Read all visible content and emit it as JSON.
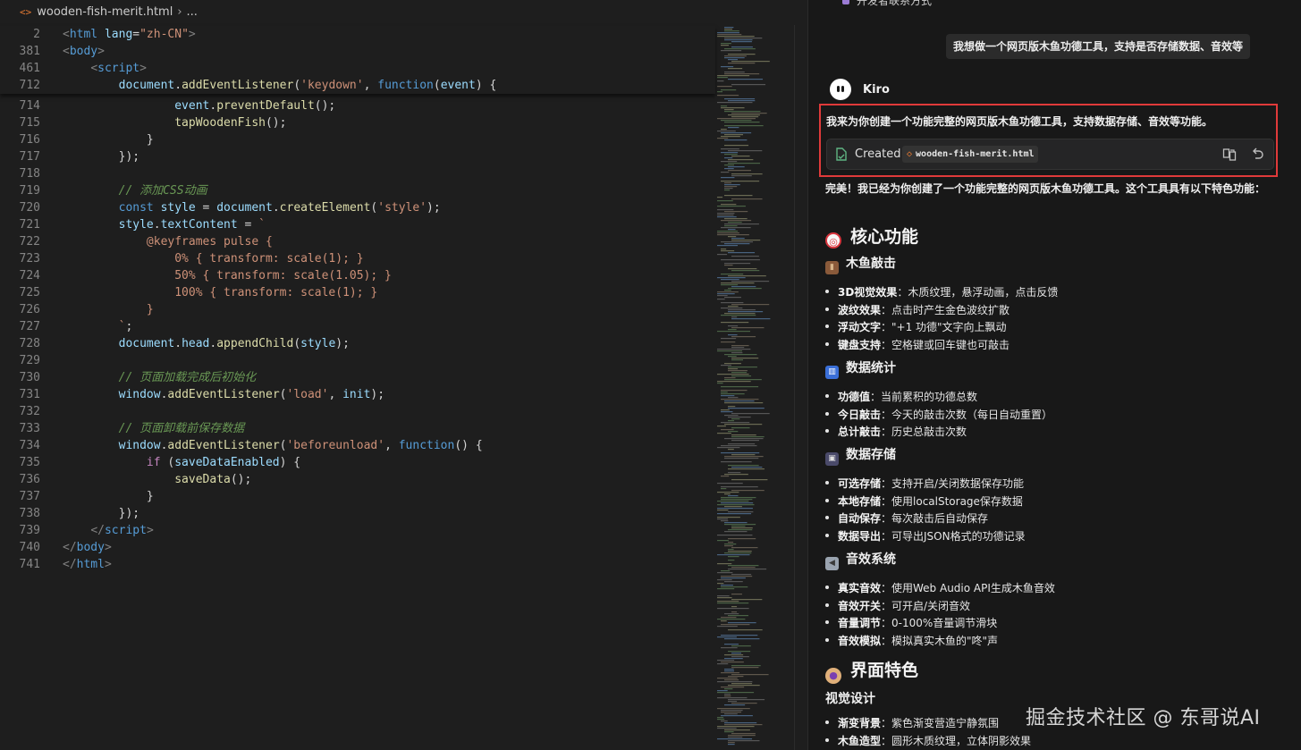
{
  "editor": {
    "file_icon": "<>",
    "filename": "wooden-fish-merit.html",
    "breadcrumb_more": "...",
    "sticky_lines": [
      {
        "n": "2",
        "html": "<span class='t-pun'>&lt;</span><span class='t-tag'>html</span> <span class='t-attr'>lang</span><span class='t-txt'>=</span><span class='t-str'>\"zh-CN\"</span><span class='t-pun'>&gt;</span>"
      },
      {
        "n": "381",
        "html": "<span class='t-pun'>&lt;</span><span class='t-tag'>body</span><span class='t-pun'>&gt;</span>"
      },
      {
        "n": "461",
        "html": "    <span class='t-pun'>&lt;</span><span class='t-tag'>script</span><span class='t-pun'>&gt;</span>"
      },
      {
        "n": "712",
        "html": "        <span class='t-var'>document</span>.<span class='t-fn'>addEventListener</span>(<span class='t-str'>'keydown'</span>, <span class='t-kw'>function</span>(<span class='t-var'>event</span>) {"
      }
    ],
    "lines": [
      {
        "n": "714",
        "html": "                <span class='t-var'>event</span>.<span class='t-fn'>preventDefault</span>();"
      },
      {
        "n": "715",
        "html": "                <span class='t-fn'>tapWoodenFish</span>();"
      },
      {
        "n": "716",
        "html": "            }"
      },
      {
        "n": "717",
        "html": "        });"
      },
      {
        "n": "718",
        "html": ""
      },
      {
        "n": "719",
        "html": "        <span class='t-com'>// 添加CSS动画</span>"
      },
      {
        "n": "720",
        "html": "        <span class='t-kw'>const</span> <span class='t-var'>style</span> = <span class='t-var'>document</span>.<span class='t-fn'>createElement</span>(<span class='t-str'>'style'</span>);"
      },
      {
        "n": "721",
        "html": "        <span class='t-var'>style</span>.<span class='t-var'>textContent</span> = <span class='t-tpl'>`</span>"
      },
      {
        "n": "722",
        "html": "<span class='t-tpl'>            @keyframes pulse {</span>"
      },
      {
        "n": "723",
        "html": "<span class='t-tpl'>                0% { transform: scale(1); }</span>"
      },
      {
        "n": "724",
        "html": "<span class='t-tpl'>                50% { transform: scale(1.05); }</span>"
      },
      {
        "n": "725",
        "html": "<span class='t-tpl'>                100% { transform: scale(1); }</span>"
      },
      {
        "n": "726",
        "html": "<span class='t-tpl'>            }</span>"
      },
      {
        "n": "727",
        "html": "<span class='t-tpl'>        `</span>;"
      },
      {
        "n": "728",
        "html": "        <span class='t-var'>document</span>.<span class='t-var'>head</span>.<span class='t-fn'>appendChild</span>(<span class='t-var'>style</span>);"
      },
      {
        "n": "729",
        "html": ""
      },
      {
        "n": "730",
        "html": "        <span class='t-com'>// 页面加载完成后初始化</span>"
      },
      {
        "n": "731",
        "html": "        <span class='t-var'>window</span>.<span class='t-fn'>addEventListener</span>(<span class='t-str'>'load'</span>, <span class='t-var'>init</span>);"
      },
      {
        "n": "732",
        "html": ""
      },
      {
        "n": "733",
        "html": "        <span class='t-com'>// 页面卸载前保存数据</span>"
      },
      {
        "n": "734",
        "html": "        <span class='t-var'>window</span>.<span class='t-fn'>addEventListener</span>(<span class='t-str'>'beforeunload'</span>, <span class='t-kw'>function</span>() {"
      },
      {
        "n": "735",
        "html": "            <span class='t-ctl'>if</span> (<span class='t-var'>saveDataEnabled</span>) {"
      },
      {
        "n": "736",
        "html": "                <span class='t-fn'>saveData</span>();"
      },
      {
        "n": "737",
        "html": "            }"
      },
      {
        "n": "738",
        "html": "        });"
      },
      {
        "n": "739",
        "html": "    <span class='t-pun'>&lt;/</span><span class='t-tag'>script</span><span class='t-pun'>&gt;</span>"
      },
      {
        "n": "740",
        "html": "<span class='t-pun'>&lt;/</span><span class='t-tag'>body</span><span class='t-pun'>&gt;</span>"
      },
      {
        "n": "741",
        "html": "<span class='t-pun'>&lt;/</span><span class='t-tag'>html</span><span class='t-pun'>&gt;</span>"
      }
    ]
  },
  "chat": {
    "prev_item": "开发者联系方式",
    "user_message": "我想做一个网页版木鱼功德工具，支持是否存储数据、音效等",
    "assistant_name": "Kiro",
    "intro": "我来为你创建一个功能完整的网页版木鱼功德工具，支持数据存储、音效等功能。",
    "created_label": "Created",
    "created_file": "wooden-fish-merit.html",
    "summary": "完美！我已经为你创建了一个功能完整的网页版木鱼功德工具。这个工具具有以下特色功能：",
    "core_title": "核心功能",
    "sections": [
      {
        "title": "木鱼敲击",
        "icon": "wood-log-icon",
        "items": [
          {
            "k": "3D视觉效果",
            "v": "：木质纹理，悬浮动画，点击反馈"
          },
          {
            "k": "波纹效果",
            "v": "：点击时产生金色波纹扩散"
          },
          {
            "k": "浮动文字",
            "v": "：\"+1 功德\"文字向上飘动"
          },
          {
            "k": "键盘支持",
            "v": "：空格键或回车键也可敲击"
          }
        ]
      },
      {
        "title": "数据统计",
        "icon": "bar-chart-icon",
        "items": [
          {
            "k": "功德值",
            "v": "：当前累积的功德总数"
          },
          {
            "k": "今日敲击",
            "v": "：今天的敲击次数（每日自动重置）"
          },
          {
            "k": "总计敲击",
            "v": "：历史总敲击次数"
          }
        ]
      },
      {
        "title": "数据存储",
        "icon": "floppy-disk-icon",
        "items": [
          {
            "k": "可选存储",
            "v": "：支持开启/关闭数据保存功能"
          },
          {
            "k": "本地存储",
            "v": "：使用localStorage保存数据"
          },
          {
            "k": "自动保存",
            "v": "：每次敲击后自动保存"
          },
          {
            "k": "数据导出",
            "v": "：可导出JSON格式的功德记录"
          }
        ]
      },
      {
        "title": "音效系统",
        "icon": "speaker-icon",
        "items": [
          {
            "k": "真实音效",
            "v": "：使用Web Audio API生成木鱼音效"
          },
          {
            "k": "音效开关",
            "v": "：可开启/关闭音效"
          },
          {
            "k": "音量调节",
            "v": "：0-100%音量调节滑块"
          },
          {
            "k": "音效模拟",
            "v": "：模拟真实木鱼的\"咚\"声"
          }
        ]
      }
    ],
    "ui_title": "界面特色",
    "visual_title": "视觉设计",
    "visual_items": [
      {
        "k": "渐变背景",
        "v": "：紫色渐变营造宁静氛围"
      },
      {
        "k": "木鱼造型",
        "v": "：圆形木质纹理，立体阴影效果"
      }
    ]
  },
  "watermark": "掘金技术社区 @ 东哥说AI",
  "colors": {
    "highlight_border": "#e03a3a",
    "editor_bg": "#1e1e1e",
    "chat_bg": "#181818"
  }
}
